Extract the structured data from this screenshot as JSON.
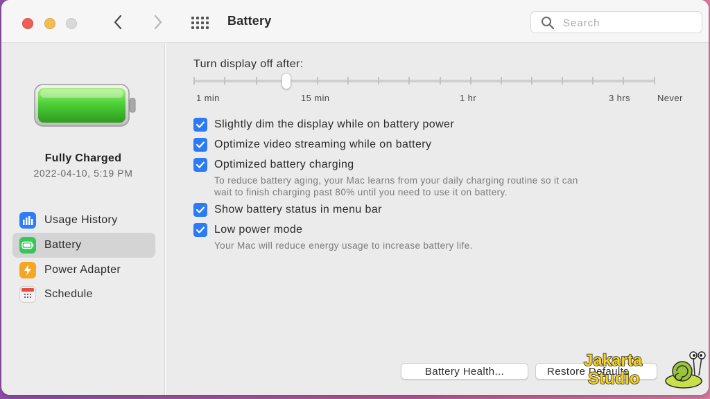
{
  "window": {
    "title": "Battery"
  },
  "search": {
    "placeholder": "Search"
  },
  "sidebar": {
    "status_title": "Fully Charged",
    "status_time": "2022-04-10, 5:19 PM",
    "items": [
      {
        "label": "Usage History",
        "icon": "bar-chart-icon",
        "color": "#2f7cf6",
        "selected": false
      },
      {
        "label": "Battery",
        "icon": "battery-icon",
        "color": "#34c759",
        "selected": true
      },
      {
        "label": "Power Adapter",
        "icon": "bolt-icon",
        "color": "#f5a623",
        "selected": false
      },
      {
        "label": "Schedule",
        "icon": "calendar-icon",
        "color": "#e94b3c",
        "selected": false
      }
    ]
  },
  "main": {
    "slider": {
      "label": "Turn display off after:",
      "tick_labels": [
        "1 min",
        "15 min",
        "1 hr",
        "3 hrs",
        "Never"
      ],
      "value": "15 min"
    },
    "options": [
      {
        "label": "Slightly dim the display while on battery power",
        "checked": true
      },
      {
        "label": "Optimize video streaming while on battery",
        "checked": true
      },
      {
        "label": "Optimized battery charging",
        "checked": true,
        "description_lines": [
          "To reduce battery aging, your Mac learns from your daily charging routine so it can",
          "wait to finish charging past 80% until you need to use it on battery."
        ]
      },
      {
        "label": "Show battery status in menu bar",
        "checked": true
      },
      {
        "label": "Low power mode",
        "checked": true,
        "description_lines": [
          "Your Mac will reduce energy usage to increase battery life."
        ]
      }
    ],
    "buttons": {
      "battery_health": "Battery Health...",
      "restore": "Restore Defaults"
    }
  },
  "watermark": {
    "line1": "Jakarta",
    "line2": "Studio"
  },
  "colors": {
    "accent": "#2a7bf5",
    "battery_green": "#4cd137"
  }
}
